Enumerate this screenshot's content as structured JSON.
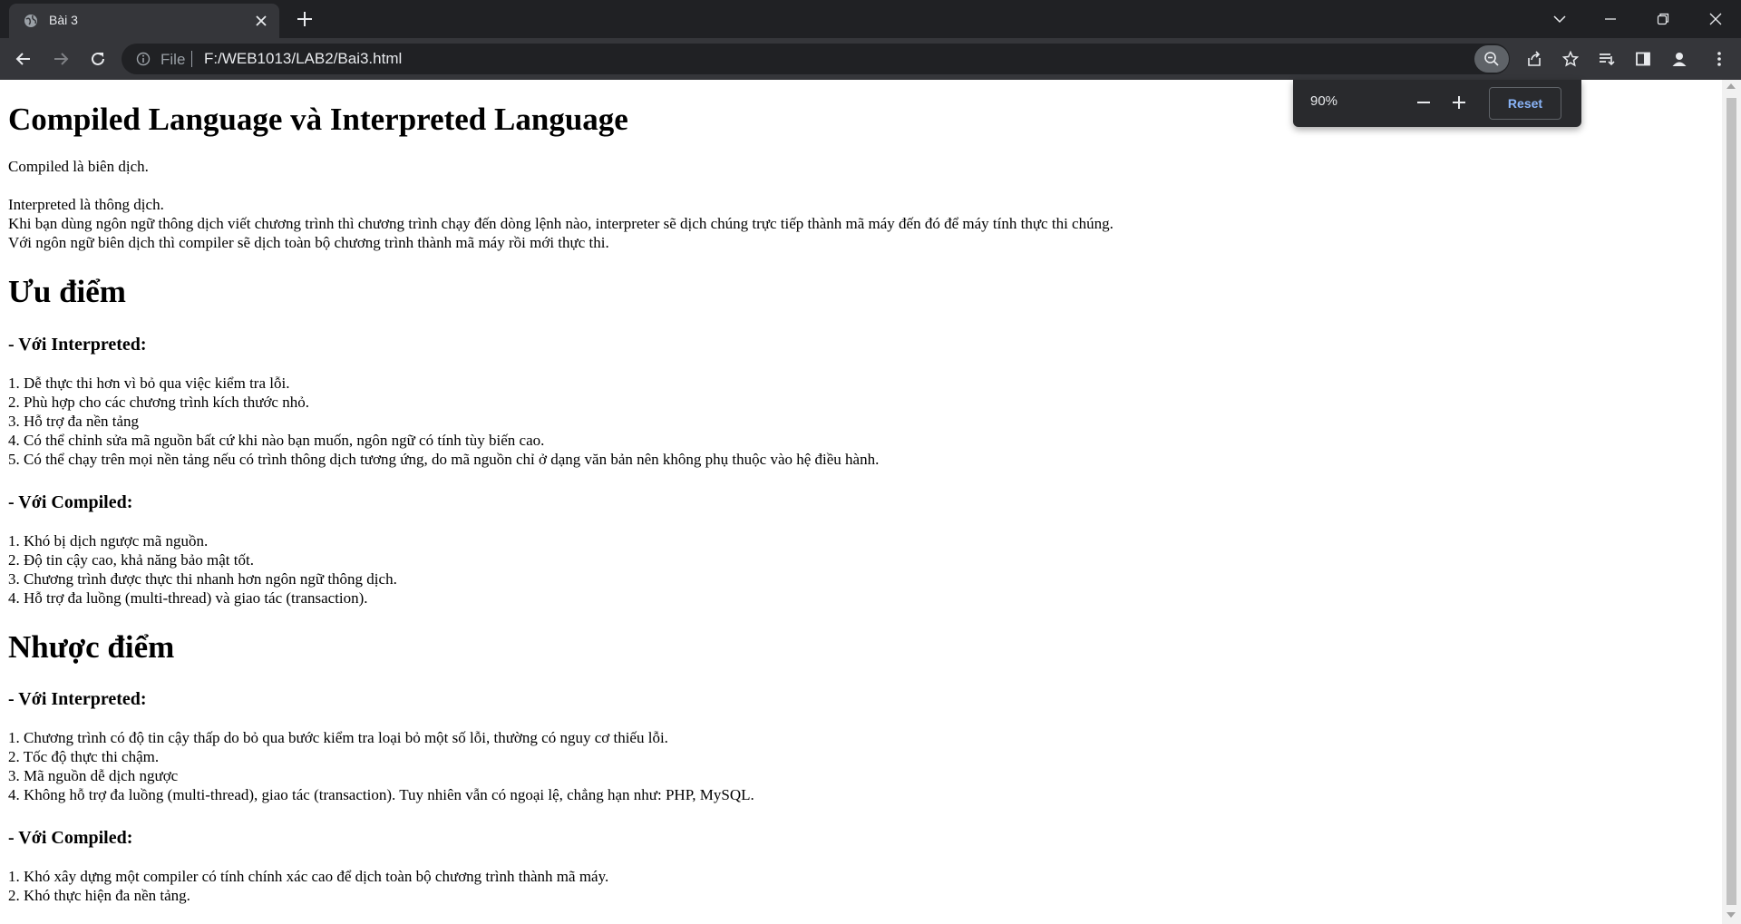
{
  "browser": {
    "tab_title": "Bài 3",
    "omnibox_scheme": "File",
    "omnibox_url": "F:/WEB1013/LAB2/Bai3.html",
    "icons": [
      "globe-icon",
      "close-icon",
      "plus-icon",
      "chevron-down-icon",
      "minimize-icon",
      "restore-icon",
      "close-window-icon",
      "back-arrow-icon",
      "forward-arrow-icon",
      "reload-icon",
      "info-icon",
      "zoom-out-icon",
      "share-icon",
      "star-icon",
      "reading-list-icon",
      "side-panel-icon",
      "profile-icon",
      "more-vert-icon"
    ]
  },
  "zoom_popup": {
    "level": "90%",
    "reset_label": "Reset"
  },
  "document": {
    "title": "Compiled Language và Interpreted Language",
    "intro": [
      "Compiled là biên dịch.",
      "Interpreted là thông dịch.",
      "Khi bạn dùng ngôn ngữ thông dịch viết chương trình thì chương trình chạy đến dòng lệnh nào, interpreter sẽ dịch chúng trực tiếp thành mã máy đến đó để máy tính thực thi chúng.",
      "Với ngôn ngữ biên dịch thì compiler sẽ dịch toàn bộ chương trình thành mã máy rồi mới thực thi."
    ],
    "advantages": {
      "heading": "Ưu điểm",
      "interpreted_heading": "- Với Interpreted:",
      "interpreted_items": [
        "1. Dễ thực thi hơn vì bỏ qua việc kiểm tra lỗi.",
        "2. Phù hợp cho các chương trình kích thước nhỏ.",
        "3. Hỗ trợ đa nền tảng",
        "4. Có thể chỉnh sửa mã nguồn bất cứ khi nào bạn muốn, ngôn ngữ có tính tùy biến cao.",
        "5. Có thể chạy trên mọi nền tảng nếu có trình thông dịch tương ứng, do mã nguồn chỉ ở dạng văn bản nên không phụ thuộc vào hệ điều hành."
      ],
      "compiled_heading": "- Với Compiled:",
      "compiled_items": [
        "1. Khó bị dịch ngược mã nguồn.",
        "2. Độ tin cậy cao, khả năng bảo mật tốt.",
        "3. Chương trình được thực thi nhanh hơn ngôn ngữ thông dịch.",
        "4. Hỗ trợ đa luồng (multi-thread) và giao tác (transaction)."
      ]
    },
    "disadvantages": {
      "heading": "Nhược điểm",
      "interpreted_heading": "- Với Interpreted:",
      "interpreted_items": [
        "1. Chương trình có độ tin cậy thấp do bỏ qua bước kiểm tra loại bỏ một số lỗi, thường có nguy cơ thiếu lỗi.",
        "2. Tốc độ thực thi chậm.",
        "3. Mã nguồn dễ dịch ngược",
        "4. Không hỗ trợ đa luồng (multi-thread), giao tác (transaction). Tuy nhiên vẫn có ngoại lệ, chẳng hạn như: PHP, MySQL."
      ],
      "compiled_heading": "- Với Compiled:",
      "compiled_items": [
        "1. Khó xây dựng một compiler có tính chính xác cao để dịch toàn bộ chương trình thành mã máy.",
        "2. Khó thực hiện đa nền tảng."
      ]
    }
  }
}
